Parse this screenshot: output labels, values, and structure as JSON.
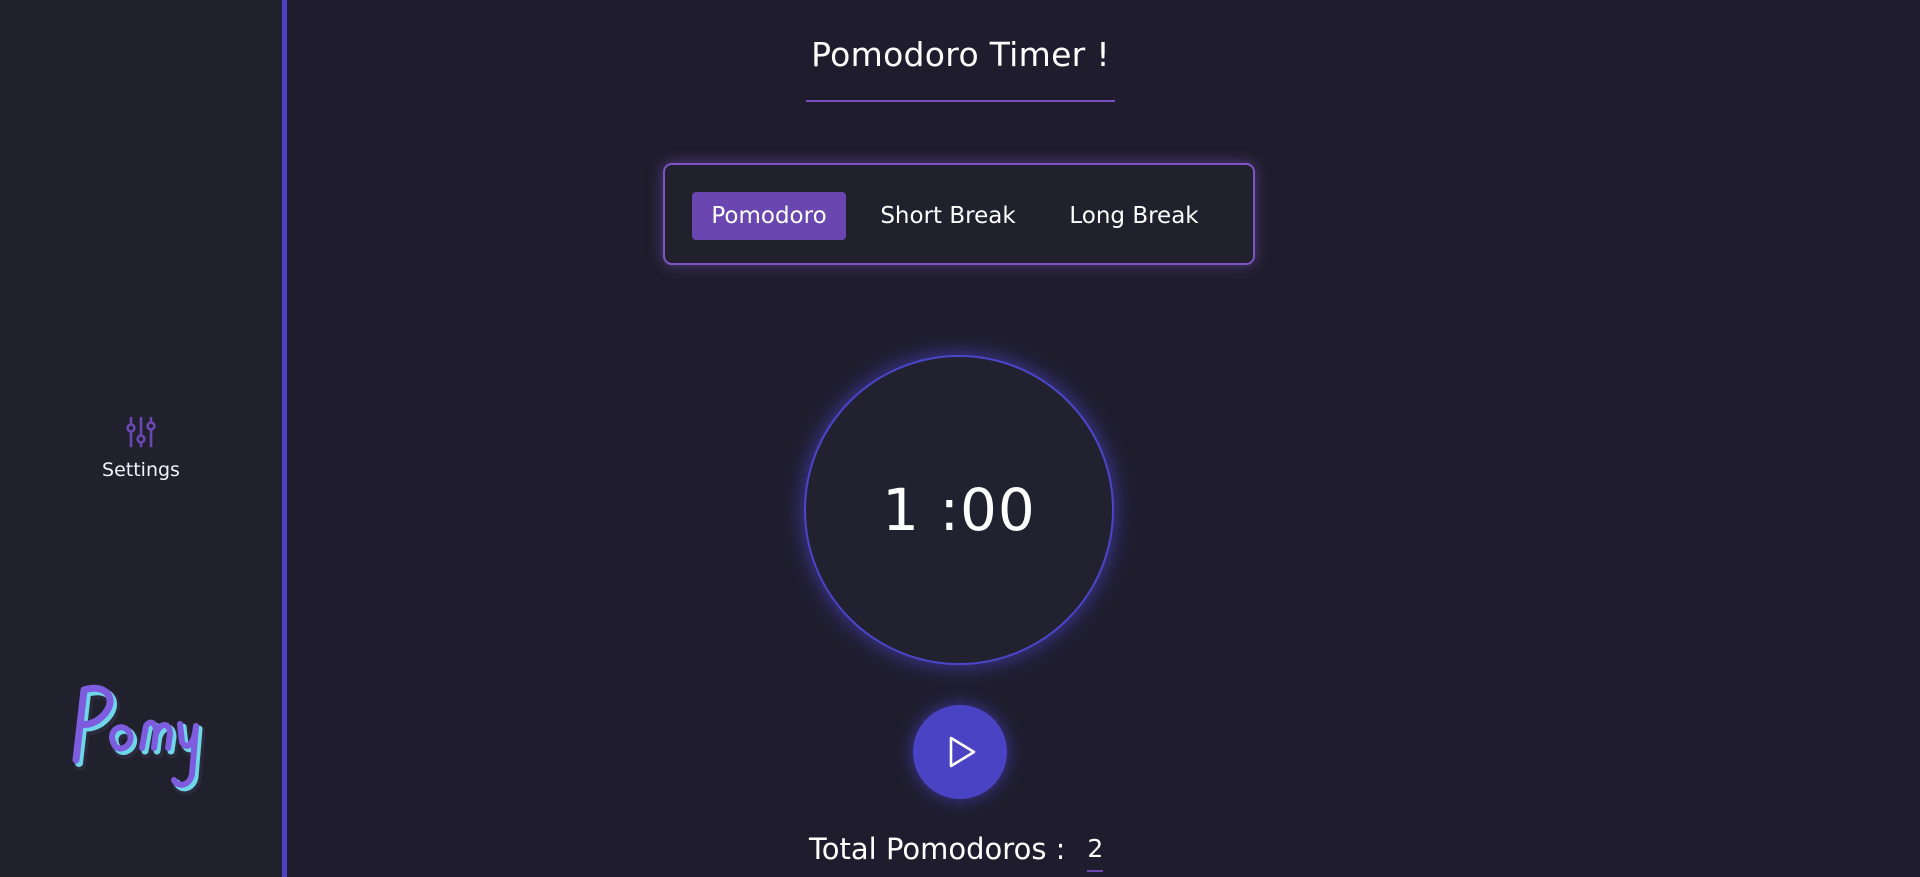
{
  "sidebar": {
    "settings": {
      "icon": "sliders-icon",
      "label": "Settings"
    },
    "logo": {
      "text": "Pomy",
      "colors": [
        "#7d5ce0",
        "#6fd6e8"
      ]
    }
  },
  "header": {
    "title": "Pomodoro Timer !"
  },
  "modes": {
    "tabs": [
      {
        "label": "Pomodoro",
        "active": true
      },
      {
        "label": "Short Break",
        "active": false
      },
      {
        "label": "Long Break",
        "active": false
      }
    ]
  },
  "timer": {
    "display": "1 :00"
  },
  "controls": {
    "play_icon": "play-icon"
  },
  "stats": {
    "total_label": "Total Pomodoros :",
    "total_count": "2"
  },
  "colors": {
    "background": "#1f1d2d",
    "sidebar": "#21212e",
    "accent_blue": "#4a43c4",
    "accent_purple": "#6a47b0"
  }
}
